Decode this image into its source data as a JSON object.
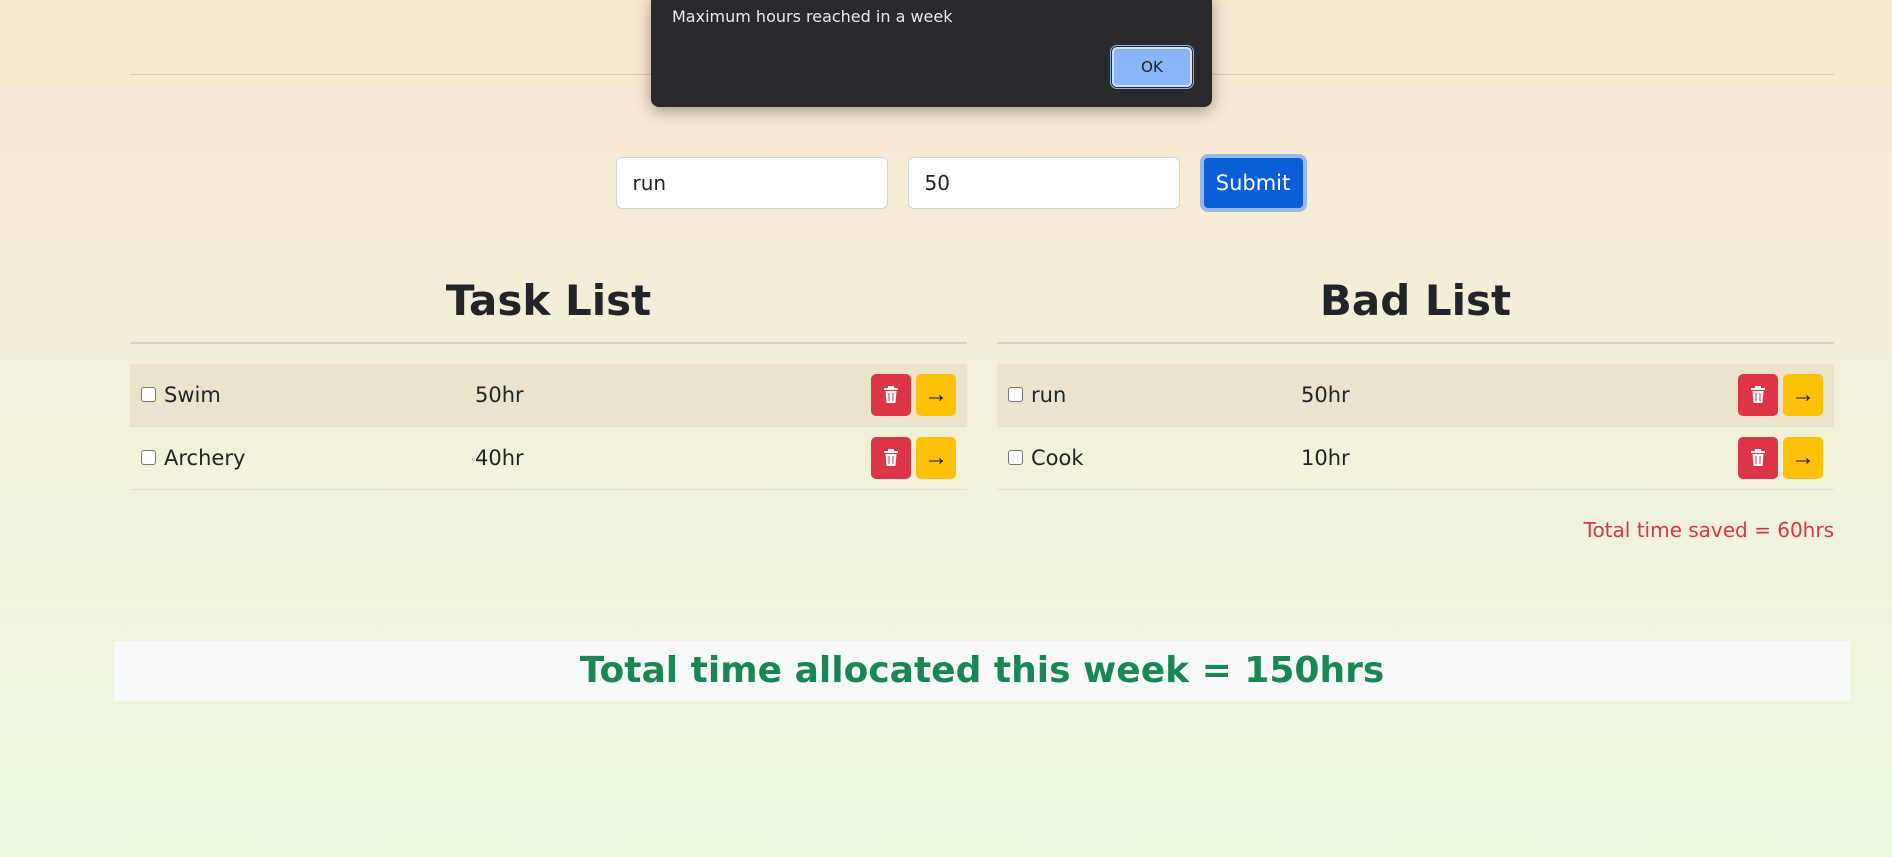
{
  "dialog": {
    "message": "Maximum hours reached in a week",
    "ok_label": "OK"
  },
  "form": {
    "task_value": "run",
    "hours_value": "50",
    "submit_label": "Submit"
  },
  "task_list": {
    "title": "Task List",
    "items": [
      {
        "name": "Swim",
        "hours": "50hr"
      },
      {
        "name": "Archery",
        "hours": "40hr"
      }
    ]
  },
  "bad_list": {
    "title": "Bad List",
    "items": [
      {
        "name": "run",
        "hours": "50hr"
      },
      {
        "name": "Cook",
        "hours": "10hr"
      }
    ],
    "saved_text": "Total time saved = 60hrs"
  },
  "summary": {
    "allocated_text": "Total time allocated this week = 150hrs"
  },
  "icons": {
    "delete": "trash-icon",
    "move": "arrow-right-icon"
  },
  "colors": {
    "primary": "#0b5ed7",
    "danger": "#dc3545",
    "warning": "#ffc107",
    "success": "#198754"
  }
}
